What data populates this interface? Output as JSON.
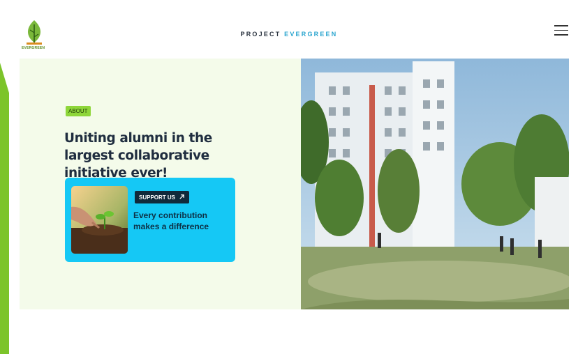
{
  "header": {
    "brand_part1": "PROJECT",
    "brand_part2": "EVERGREEN",
    "logo_text": "EVERGREEN"
  },
  "hero": {
    "badge": "ABOUT",
    "headline": "Uniting alumni in the largest collaborative initiative ever!",
    "card": {
      "button_label": "SUPPORT US",
      "button_icon": "arrow-up-right-icon",
      "text": "Every contribution makes a difference"
    }
  },
  "colors": {
    "accent_green": "#8ed63a",
    "hero_bg": "#f4fbea",
    "card_bg": "#15c8f5",
    "brand_blue": "#2aa5cf"
  }
}
